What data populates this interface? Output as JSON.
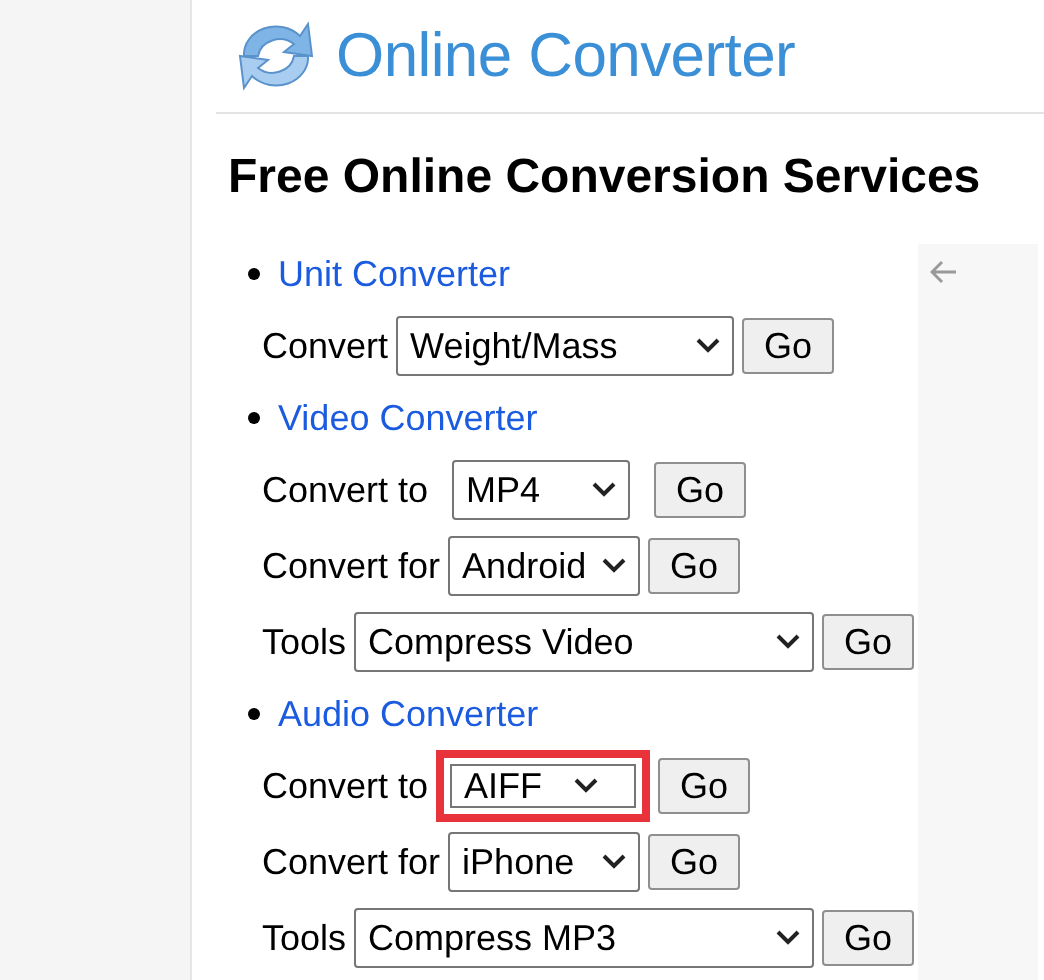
{
  "site": {
    "title": "Online Converter"
  },
  "heading": "Free Online Conversion Services",
  "converters": [
    {
      "title": "Unit Converter",
      "rows": [
        {
          "label": "Convert",
          "value": "Weight/Mass",
          "highlighted": false,
          "button": "Go"
        }
      ]
    },
    {
      "title": "Video Converter",
      "rows": [
        {
          "label": "Convert to",
          "value": "MP4",
          "highlighted": false,
          "button": "Go"
        },
        {
          "label": "Convert for",
          "value": "Android",
          "highlighted": false,
          "button": "Go"
        },
        {
          "label": "Tools",
          "value": "Compress Video",
          "highlighted": false,
          "button": "Go"
        }
      ]
    },
    {
      "title": "Audio Converter",
      "rows": [
        {
          "label": "Convert to",
          "value": "AIFF",
          "highlighted": true,
          "button": "Go"
        },
        {
          "label": "Convert for",
          "value": "iPhone",
          "highlighted": false,
          "button": "Go"
        },
        {
          "label": "Tools",
          "value": "Compress MP3",
          "highlighted": false,
          "button": "Go"
        }
      ]
    }
  ]
}
